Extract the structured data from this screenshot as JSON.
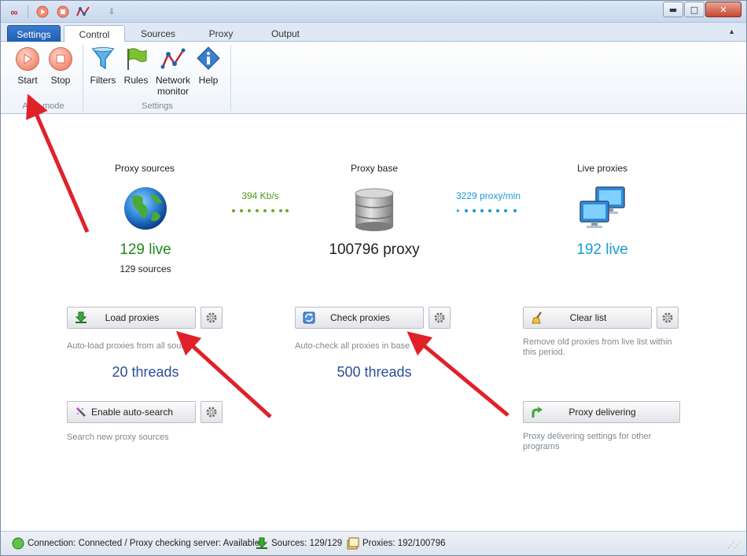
{
  "titlebar": {
    "icons": [
      "infinity-icon",
      "start-icon",
      "stop-icon",
      "network-icon",
      "pin-icon"
    ],
    "minimize_label": "▬",
    "maximize_label": "□",
    "close_label": "✕"
  },
  "tabs": [
    {
      "label": "Settings"
    },
    {
      "label": "Control"
    },
    {
      "label": "Sources"
    },
    {
      "label": "Proxy"
    },
    {
      "label": "Output"
    }
  ],
  "ribbon": {
    "groups": [
      {
        "label": "Auto mode",
        "buttons": [
          {
            "label": "Start",
            "icon": "play-icon"
          },
          {
            "label": "Stop",
            "icon": "stop-icon"
          }
        ]
      },
      {
        "label": "Settings",
        "buttons": [
          {
            "label": "Filters",
            "icon": "funnel-icon"
          },
          {
            "label": "Rules",
            "icon": "flag-icon"
          },
          {
            "label": "Network monitor",
            "icon": "network-icon"
          },
          {
            "label": "Help",
            "icon": "info-icon"
          }
        ]
      }
    ]
  },
  "overview": {
    "sources": {
      "title": "Proxy sources",
      "live": "129 live",
      "count": "129 sources"
    },
    "base": {
      "title": "Proxy base",
      "count": "100796 proxy"
    },
    "live": {
      "title": "Live proxies",
      "count": "192 live"
    },
    "rate_in": "394 Kb/s",
    "rate_out": "3229 proxy/min"
  },
  "actions": {
    "load": {
      "label": "Load proxies",
      "desc": "Auto-load proxies from all sources",
      "threads": "20 threads"
    },
    "check": {
      "label": "Check proxies",
      "desc": "Auto-check all proxies in base",
      "threads": "500 threads"
    },
    "clear": {
      "label": "Clear list",
      "desc": "Remove old proxies from live list within this period."
    },
    "search": {
      "label": "Enable auto-search",
      "desc": "Search new proxy sources"
    },
    "deliver": {
      "label": "Proxy delivering",
      "desc": "Proxy delivering settings for other programs"
    }
  },
  "status": {
    "connection": "Connection: Connected / Proxy checking server: Available",
    "sources": "Sources: 129/129",
    "proxies": "Proxies: 192/100796"
  },
  "colors": {
    "green": "#1e8a1e",
    "blue": "#1a9ad6",
    "navy": "#2a4f96",
    "arrow": "#e0212a"
  }
}
